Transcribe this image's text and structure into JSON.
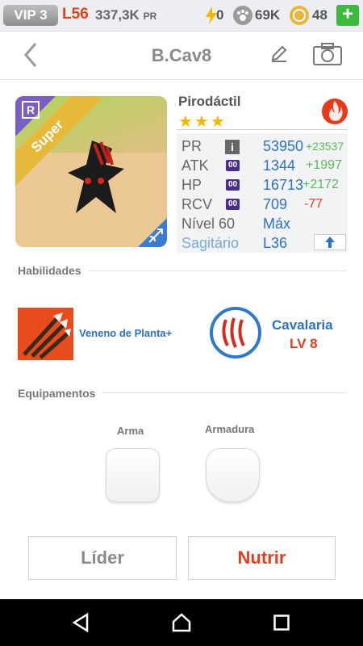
{
  "topbar": {
    "vip": "VIP 3",
    "level": "L56",
    "pr_value": "337,3K",
    "pr_unit": "PR",
    "energy": "0",
    "paws": "69K",
    "coins": "48",
    "plus_label": "+"
  },
  "header": {
    "title": "B.Cav8"
  },
  "monster": {
    "badge_rank": "R",
    "badge_tier": "Super",
    "name": "Pirodáctil",
    "stars": "★★★"
  },
  "stats": {
    "pr_label": "PR",
    "pr_value": "53950",
    "pr_bonus": "+23537",
    "atk_label": "ATK",
    "atk_chip": "00",
    "atk_value": "1344",
    "atk_bonus": "+1997",
    "hp_label": "HP",
    "hp_chip": "00",
    "hp_value": "16713",
    "hp_bonus": "+2172",
    "rcv_label": "RCV",
    "rcv_chip": "00",
    "rcv_value": "709",
    "rcv_bonus": "-77",
    "level_label": "Nível 60",
    "level_value": "Máx",
    "sign_label": "Sagitário",
    "sign_value": "L36",
    "info_glyph": "i"
  },
  "abilities": {
    "section": "Habilidades",
    "skill1_name": "Veneno de Planta+",
    "skill2_name": "Cavalaria",
    "skill2_level": "LV 8"
  },
  "equipment": {
    "section": "Equipamentos",
    "weapon_label": "Arma",
    "armor_label": "Armadura"
  },
  "buttons": {
    "leader": "Líder",
    "feed": "Nutrir"
  },
  "colors": {
    "accent_blue": "#2c72c4",
    "accent_red": "#e0401d",
    "bonus_green": "#5cb85c"
  }
}
